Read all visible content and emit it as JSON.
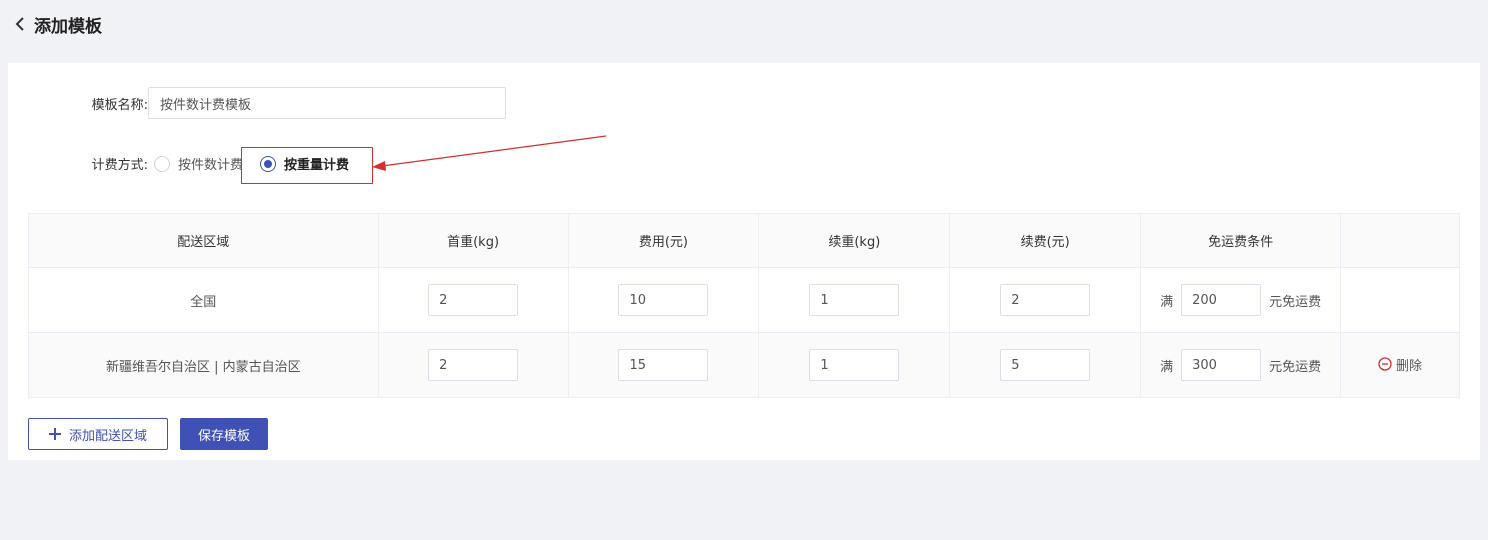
{
  "header": {
    "title": "添加模板"
  },
  "form": {
    "name_label": "模板名称:",
    "name_value": "按件数计费模板",
    "billing_label": "计费方式:",
    "billing_options": [
      {
        "label": "按件数计费",
        "checked": false
      },
      {
        "label": "按重量计费",
        "checked": true
      }
    ]
  },
  "table": {
    "columns": [
      "配送区域",
      "首重(kg)",
      "费用(元)",
      "续重(kg)",
      "续费(元)",
      "免运费条件",
      ""
    ],
    "rows": [
      {
        "region": "全国",
        "first_weight": "2",
        "fee": "10",
        "extra_weight": "1",
        "extra_fee": "2",
        "free_amount": "200",
        "deletable": false
      },
      {
        "region": "新疆维吾尔自治区 | 内蒙古自治区",
        "first_weight": "2",
        "fee": "15",
        "extra_weight": "1",
        "extra_fee": "5",
        "free_amount": "300",
        "deletable": true
      }
    ],
    "free_prefix": "满",
    "free_suffix": "元免运费",
    "delete_label": "删除"
  },
  "buttons": {
    "add_region": "添加配送区域",
    "save": "保存模板"
  },
  "colors": {
    "primary": "#3f51b5",
    "highlight": "#d32f2f",
    "delete_icon": "#d32f2f"
  }
}
